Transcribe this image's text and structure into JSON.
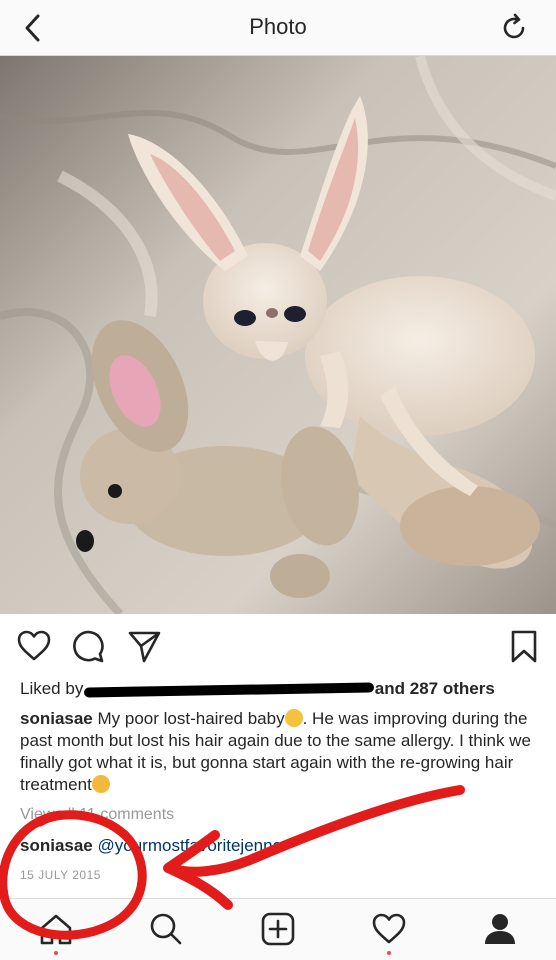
{
  "nav": {
    "title": "Photo"
  },
  "post": {
    "liked_prefix": "Liked by",
    "liked_suffix": "and 287 others",
    "caption": {
      "user": "soniasae",
      "text_part1": "My poor lost-haired baby",
      "text_part2": ". He was improving during the past month but lost his hair again due to the same allergy. I think we finally got what it is, but gonna start again with the re-growing hair treatment",
      "emoji_1": "crying-cat-emoji",
      "emoji_2": "pensive-face-emoji"
    },
    "view_all_comments": "View all 11 comments",
    "comment": {
      "user": "soniasae",
      "mention": "@yourmostfavoritejenner"
    },
    "date": "15 JULY 2015"
  },
  "icons": {
    "back": "chevron-left-icon",
    "refresh": "refresh-icon",
    "like": "heart-icon",
    "comment": "comment-icon",
    "share": "send-icon",
    "save": "bookmark-icon",
    "home": "home-icon",
    "search": "search-icon",
    "add": "add-post-icon",
    "activity": "heart-icon",
    "profile": "profile-icon"
  },
  "colors": {
    "annotation_red": "#e21b1b",
    "notification_dot": "#ed4956"
  }
}
